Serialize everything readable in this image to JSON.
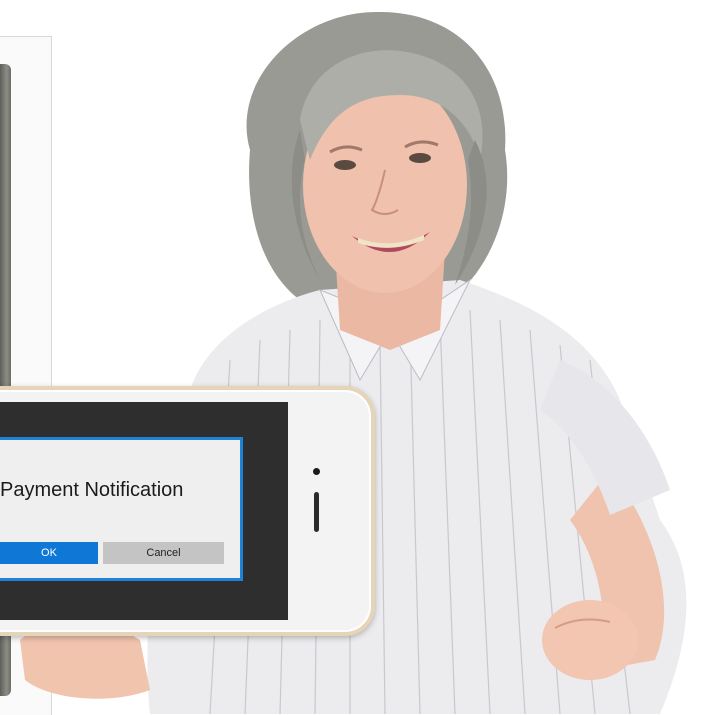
{
  "dialog": {
    "title": "Payment Notification",
    "ok_label": "OK",
    "cancel_label": "Cancel"
  },
  "colors": {
    "dialog_border": "#1d83d6",
    "ok_button": "#0f78d6",
    "cancel_button": "#c4c4c4",
    "screen": "#2e2e2e"
  },
  "icons": [
    "phone-camera-icon",
    "phone-speaker-icon"
  ]
}
